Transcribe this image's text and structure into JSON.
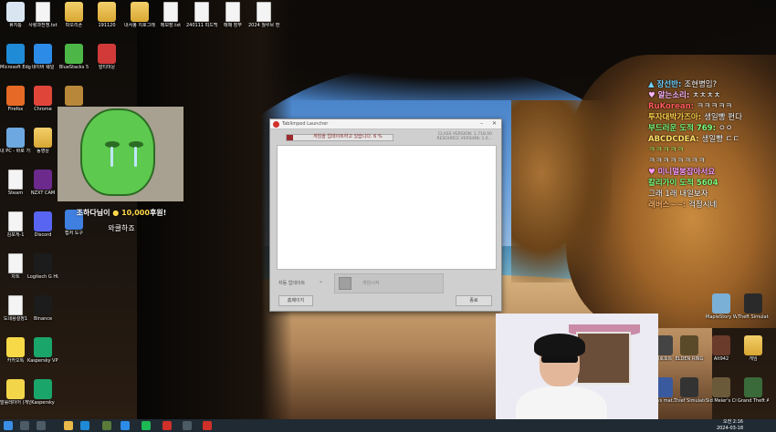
{
  "desktop_icons_left": [
    {
      "label": "휴지통",
      "kind": "recycle",
      "color": "#d9e6f2"
    },
    {
      "label": "Microsoft Edge",
      "kind": "app",
      "color": "#1f8ad6"
    },
    {
      "label": "Firefox",
      "kind": "app",
      "color": "#e66a25"
    },
    {
      "label": "내 PC - 바로 가기",
      "kind": "app",
      "color": "#6da8e0"
    },
    {
      "label": "Steam",
      "kind": "doc",
      "color": "#f4f4f4"
    },
    {
      "label": "김포게-1",
      "kind": "doc",
      "color": "#f4f4f4"
    },
    {
      "label": "차트",
      "kind": "doc",
      "color": "#f4f4f4"
    },
    {
      "label": "도네용설정1",
      "kind": "doc",
      "color": "#f4f4f4"
    },
    {
      "label": "카카오톡",
      "kind": "app",
      "color": "#f7d948"
    },
    {
      "label": "말롤레이어 (게임 전용)",
      "kind": "app",
      "color": "#f3d54a"
    }
  ],
  "desktop_icons_col2": [
    {
      "label": "사랑과전쟁.txt",
      "kind": "doc",
      "color": "#f4f4f4"
    },
    {
      "label": "네이버 웨일",
      "kind": "app",
      "color": "#2c8be6"
    },
    {
      "label": "Chrome",
      "kind": "app",
      "color": "#e0453a"
    },
    {
      "label": "동영상",
      "kind": "folder",
      "color": "#e9b949"
    },
    {
      "label": "NZXT CAM",
      "kind": "app",
      "color": "#6b2a8c"
    },
    {
      "label": "Discord",
      "kind": "app",
      "color": "#5865f2"
    },
    {
      "label": "Logitech G HUB",
      "kind": "app",
      "color": "#1c1c1c"
    },
    {
      "label": "Binance",
      "kind": "app",
      "color": "#1c1c1c"
    },
    {
      "label": "Kaspersky VPN",
      "kind": "app",
      "color": "#1aa56b"
    },
    {
      "label": "Kaspersky",
      "kind": "app",
      "color": "#1aa56b"
    }
  ],
  "desktop_icons_top": [
    {
      "label": "파오리폰",
      "kind": "folder",
      "color": "#e9b949"
    },
    {
      "label": "191120",
      "kind": "folder",
      "color": "#e9b949"
    },
    {
      "label": "내서봉 치호그래피",
      "kind": "folder",
      "color": "#e9b949"
    },
    {
      "label": "메모장.txt",
      "kind": "doc",
      "color": "#f4f4f4"
    },
    {
      "label": "240111 피드백.txt",
      "kind": "doc",
      "color": "#f4f4f4"
    },
    {
      "label": "매매 장부",
      "kind": "doc",
      "color": "#f4f4f4"
    },
    {
      "label": "2024 월루브 편집자 지...",
      "kind": "doc",
      "color": "#f4f4f4"
    }
  ],
  "desktop_icons_col3": [
    {
      "label": "BlueStacks 5",
      "kind": "app",
      "color": "#4cb747"
    },
    {
      "label": "멀티마운",
      "kind": "app",
      "color": "#d23a3a"
    },
    {
      "label": "",
      "kind": "app",
      "color": "#b8873a"
    },
    {
      "label": "캡처 도구",
      "kind": "app",
      "color": "#3f7fe0"
    }
  ],
  "desktop_icons_right": [
    {
      "label": "MapleStory Worlds",
      "kind": "app",
      "color": "#7bb0d6"
    },
    {
      "label": "Theft Simulator 2",
      "kind": "app",
      "color": "#2a2a2a"
    },
    {
      "label": "게임",
      "kind": "folder",
      "color": "#e9b949"
    },
    {
      "label": "Grand Theft Auto V",
      "kind": "app",
      "color": "#3a6a3a"
    },
    {
      "label": "ELDEN RING",
      "kind": "app",
      "color": "#5a4a2a"
    },
    {
      "label": "Alt942",
      "kind": "app",
      "color": "#6a3a2a"
    },
    {
      "label": "Thief Simulator",
      "kind": "app",
      "color": "#333"
    },
    {
      "label": "Sid Meier's Civilizati...",
      "kind": "app",
      "color": "#6a5a3a"
    },
    {
      "label": "Guys mat...",
      "kind": "app",
      "color": "#3a5aa0"
    },
    {
      "label": "미로포트",
      "kind": "app",
      "color": "#444"
    }
  ],
  "donation": {
    "name": "조하다님이",
    "amount": "10,000",
    "suffix": "후원!",
    "message": "와쿨하죠"
  },
  "launcher": {
    "title": "Tablimped Launcher",
    "progress_text": "게임을 업데이트하고 있습니다. 6 %",
    "progress_value": 0.06,
    "class_version": "CLASS VERSION: 1.718.00",
    "resource_version": "RESOURCE VERSION: 1.6...",
    "auto_update_label": "자동 업데이트",
    "start_button": "게임시작",
    "homepage_button": "홈페이지",
    "exit_button": "종료",
    "accent": "#9b2b2f"
  },
  "chat": [
    {
      "nick": "▲ 장선반",
      "msg": "조현병임?",
      "color": "#6fd3ff"
    },
    {
      "nick": "♥ 알는소리",
      "msg": "ㅊㅊㅊㅊ",
      "color": "#ffb6ff"
    },
    {
      "nick": "RuKorean",
      "msg": "ㅋㅋㅋㅋㅋ",
      "color": "#ff5a5a"
    },
    {
      "nick": "투자대박가즈아",
      "msg": "생일빵 펀다",
      "color": "#ffd24a"
    },
    {
      "nick": "부드러운 도적 769",
      "msg": "ㅇㅇ",
      "color": "#7cff7c"
    },
    {
      "nick": "ABCDCDEA",
      "msg": "생일빵 ㄷㄷ",
      "color": "#ffe066"
    },
    {
      "nick": "",
      "msg": "ㅋㅋㅋㅋㅋ",
      "color": "#c4ff6a"
    },
    {
      "nick": "",
      "msg": "ㅋㅋㅋㅋㅋㅋㅋㅋ",
      "color": "#ffffff"
    },
    {
      "nick": "♥ 미니멀봉잡아서요",
      "msg": "",
      "color": "#ff9bff"
    },
    {
      "nick": "칼리가이 도적 5604",
      "msg": "",
      "color": "#7cff7c"
    },
    {
      "nick": "",
      "msg": "그래 1래 내일보자",
      "color": "#ffffff"
    },
    {
      "nick": "래버스~~",
      "msg": "걱정시네",
      "color": "#ffb36b"
    }
  ],
  "taskbar": {
    "time": "오전 2:16",
    "date": "2024-03-18"
  }
}
